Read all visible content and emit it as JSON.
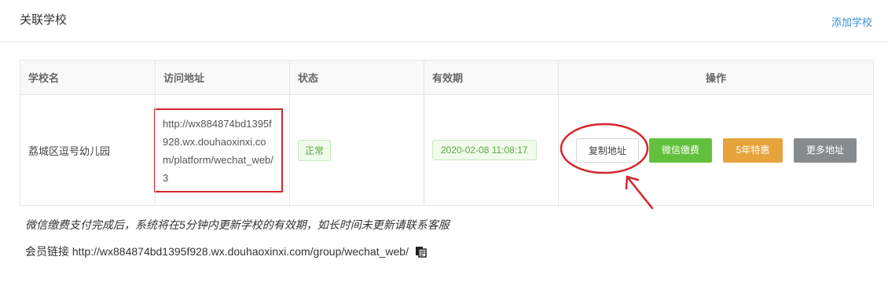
{
  "header": {
    "title": "关联学校",
    "add_link": "添加学校"
  },
  "table": {
    "headers": [
      "学校名",
      "访问地址",
      "状态",
      "有效期",
      "操作"
    ],
    "rows": [
      {
        "school_name": "荔城区逗号幼儿园",
        "access_url": "http://wx884874bd1395f928.wx.douhaoxinxi.com/platform/wechat_web/3",
        "status": "正常",
        "expiry": "2020-02-08 11:08:17",
        "actions": {
          "copy": "复制地址",
          "wechat_pay": "微信缴费",
          "five_year": "5年特惠",
          "more": "更多地址"
        }
      }
    ]
  },
  "note": "微信缴费支付完成后，系统将在5分钟内更新学校的有效期，如长时间未更新请联系客服",
  "member": {
    "label": "会员链接",
    "url": "http://wx884874bd1395f928.wx.douhaoxinxi.com/group/wechat_web/"
  },
  "annotations": {
    "highlight_color": "#d4262e"
  }
}
